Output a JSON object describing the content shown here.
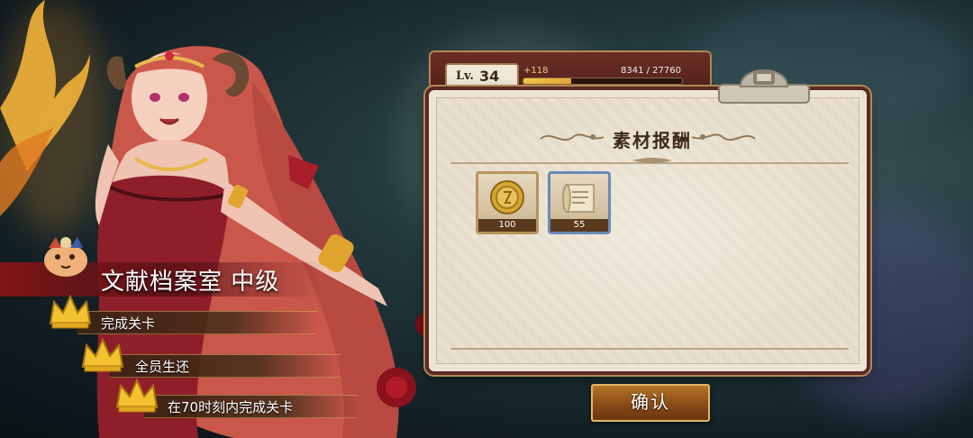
{
  "stage": {
    "title": "文献档案室 中级",
    "objectives": [
      {
        "label": "完成关卡"
      },
      {
        "label": "全员生还"
      },
      {
        "label": "在70时刻内完成关卡"
      }
    ]
  },
  "player": {
    "level_label": "Lv.",
    "level": "34",
    "exp_gain": "+118",
    "exp_text": "8341 / 27760",
    "exp_fraction": 0.3
  },
  "rewards": {
    "title": "素材报酬",
    "items": [
      {
        "icon": "gold-coin-icon",
        "quantity": "100"
      },
      {
        "icon": "scroll-icon",
        "quantity": "55"
      }
    ]
  },
  "confirm_label": "确认",
  "colors": {
    "panel_bg": "#e9e1cf",
    "panel_frame": "#5a2a22",
    "accent_gold": "#e2b766",
    "button": "#8a4a16",
    "stage_banner": "#96141a"
  }
}
